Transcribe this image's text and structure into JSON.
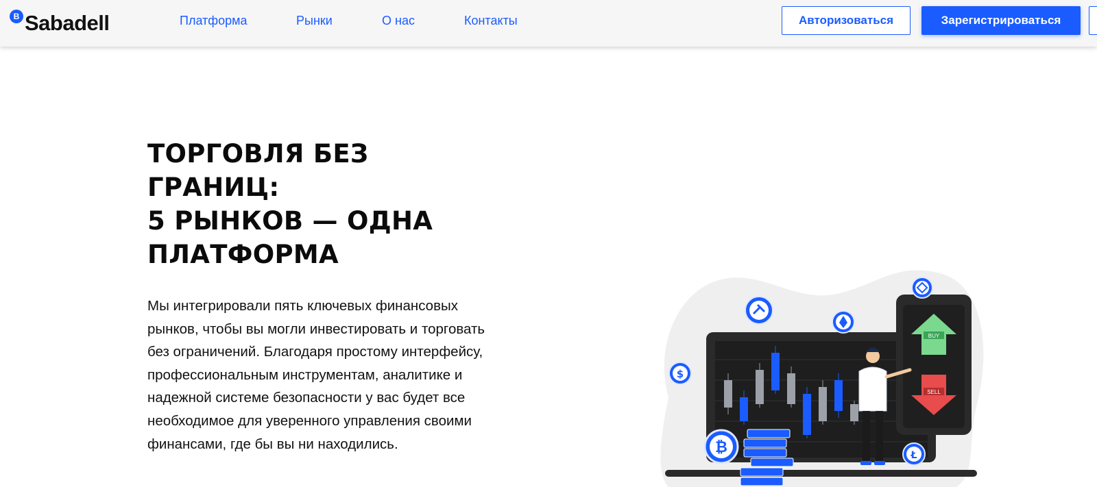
{
  "header": {
    "logo": {
      "badge": "B",
      "text": "Sabadell"
    },
    "nav": [
      {
        "label": "Платформа"
      },
      {
        "label": "Рынки"
      },
      {
        "label": "О нас"
      },
      {
        "label": "Контакты"
      }
    ],
    "login_label": "Авторизоваться",
    "register_label": "Зарегистрироваться"
  },
  "hero": {
    "title_lines": [
      "ТОРГОВЛЯ БЕЗ",
      "ГРАНИЦ:",
      "5 РЫНКОВ — ОДНА",
      "ПЛАТФОРМА"
    ],
    "paragraph": "Мы интегрировали пять ключевых финансовых рынков, чтобы вы могли инвестировать и торговать без ограничений. Благодаря простому интерфейсу, профессиональным инструментам, аналитике и надежной системе безопасности у вас будет все необходимое для уверенного управления своими финансами, где бы вы ни находились."
  },
  "illustration": {
    "buy_label": "BUY",
    "sell_label": "SELL",
    "icons": [
      "bitcoin-coin-icon",
      "litecoin-coin-icon",
      "dollar-coin-icon",
      "hammer-coin-icon",
      "ethereum-coin-icon",
      "binance-coin-icon"
    ],
    "colors": {
      "accent": "#1a5cff",
      "buy": "#7bd88f",
      "sell": "#e84c4c",
      "screen": "#2a2a2a",
      "bg_blob": "#efefef"
    }
  }
}
